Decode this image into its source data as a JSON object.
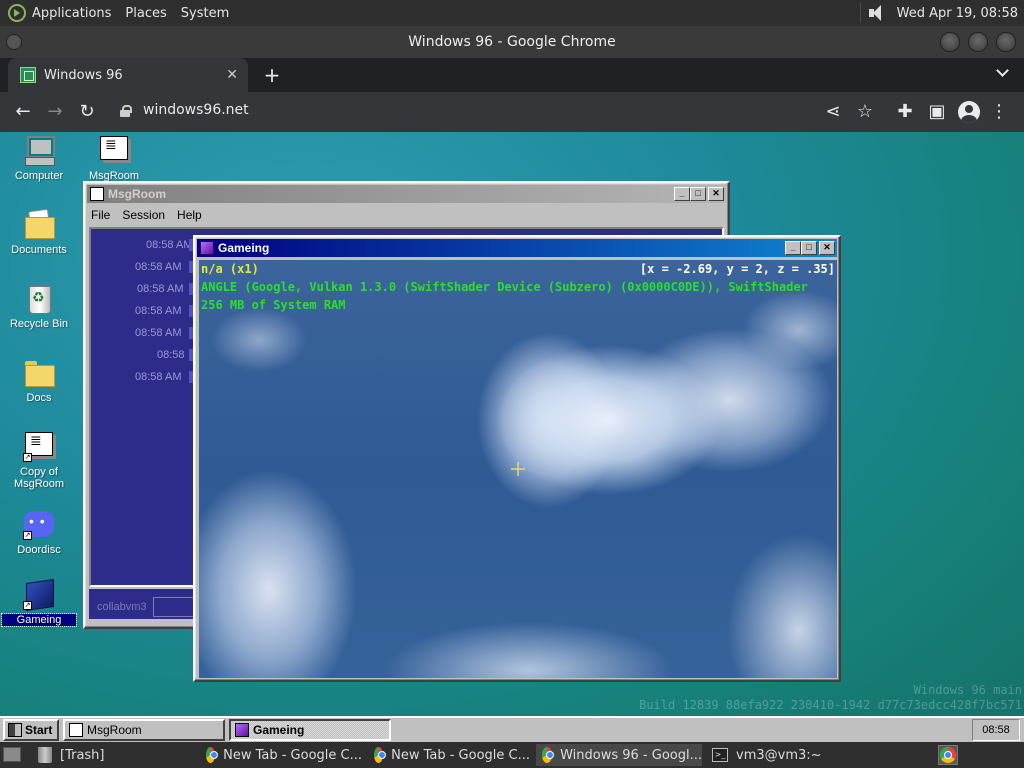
{
  "top_panel": {
    "menus": [
      "Applications",
      "Places",
      "System"
    ],
    "clock": "Wed Apr 19, 08:58"
  },
  "chrome": {
    "window_title": "Windows 96 - Google Chrome",
    "tab_title": "Windows 96",
    "url": "windows96.net"
  },
  "desktop": {
    "icons": [
      {
        "label": "Computer"
      },
      {
        "label": "MsgRoom"
      },
      {
        "label": "Documents"
      },
      {
        "label": "Recycle Bin"
      },
      {
        "label": "Docs"
      },
      {
        "label": "Copy of MsgRoom"
      },
      {
        "label": "Doordisc"
      },
      {
        "label": "Gameing"
      }
    ],
    "build_info": [
      "Windows 96 main",
      "Build 12839 88efa922 230410-1942 d77c73edcc428f7bc571"
    ]
  },
  "msgroom": {
    "title": "MsgRoom",
    "menu": [
      "File",
      "Session",
      "Help"
    ],
    "times": [
      "08:58 AM",
      "08:58 AM",
      "08:58 AM",
      "08:58 AM",
      "08:58 AM",
      "08:58",
      "08:58 AM"
    ],
    "nick": "collabvm3"
  },
  "gameing": {
    "title": "Gameing",
    "hud_line1": "n/a (x1)",
    "hud_coords": "[x = -2.69, y = 2, z = .35]",
    "hud_line2": "ANGLE (Google, Vulkan 1.3.0 (SwiftShader Device (Subzero) (0x0000C0DE)), SwiftShader",
    "hud_line3": "256 MB of System RAM"
  },
  "w96_taskbar": {
    "start": "Start",
    "tasks": [
      "MsgRoom",
      "Gameing"
    ],
    "clock": "08:58"
  },
  "bottom_panel": {
    "items": [
      "[Trash]",
      "New Tab - Google C...",
      "New Tab - Google C...",
      "Windows 96 - Googl...",
      "vm3@vm3:~"
    ]
  },
  "colors": {
    "desktop_teal": "#1e8a9c",
    "win95_gray": "#c0c0c0",
    "active_title": "#000080",
    "hud_green": "#28e028"
  }
}
